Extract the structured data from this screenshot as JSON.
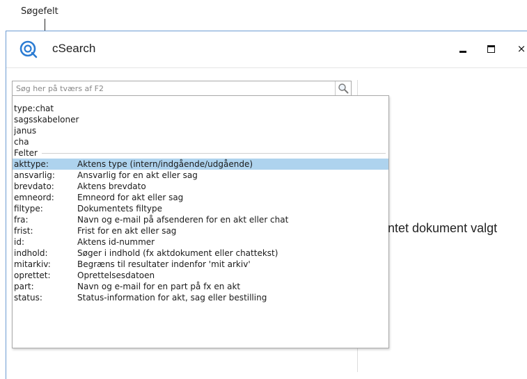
{
  "callout": {
    "label": "Søgefelt"
  },
  "window": {
    "title": "cSearch",
    "minimize_icon": "minimize-icon",
    "maximize_icon": "maximize-icon",
    "close_icon": "close-icon",
    "close_glyph": "×"
  },
  "search": {
    "placeholder": "Søg her på tværs af F2",
    "value": "",
    "icon": "search-icon"
  },
  "dropdown": {
    "suggestions": [
      "type:chat",
      "sagsskabeloner",
      "janus",
      "cha"
    ],
    "section_label": "Felter",
    "fields": [
      {
        "name": "akttype:",
        "desc": "Aktens type (intern/indgående/udgående)",
        "selected": true
      },
      {
        "name": "ansvarlig:",
        "desc": "Ansvarlig for en akt eller sag"
      },
      {
        "name": "brevdato:",
        "desc": "Aktens brevdato"
      },
      {
        "name": "emneord:",
        "desc": "Emneord for akt eller sag"
      },
      {
        "name": "filtype:",
        "desc": "Dokumentets filtype"
      },
      {
        "name": "fra:",
        "desc": "Navn og e-mail på afsenderen for en akt eller chat"
      },
      {
        "name": "frist:",
        "desc": "Frist for en akt eller sag"
      },
      {
        "name": "id:",
        "desc": "Aktens id-nummer"
      },
      {
        "name": "indhold:",
        "desc": "Søger i indhold (fx aktdokument eller chattekst)"
      },
      {
        "name": "mitarkiv:",
        "desc": "Begræns til resultater indenfor 'mit arkiv'"
      },
      {
        "name": "oprettet:",
        "desc": "Oprettelsesdatoen"
      },
      {
        "name": "part:",
        "desc": "Navn og e-mail for en part på fx en akt"
      },
      {
        "name": "status:",
        "desc": "Status-information for akt, sag eller bestilling"
      }
    ]
  },
  "main": {
    "empty_text": "ntet dokument valgt"
  },
  "colors": {
    "accent": "#2b7cd3",
    "selection": "#aed3ee",
    "window_border": "#6c9bd2"
  }
}
